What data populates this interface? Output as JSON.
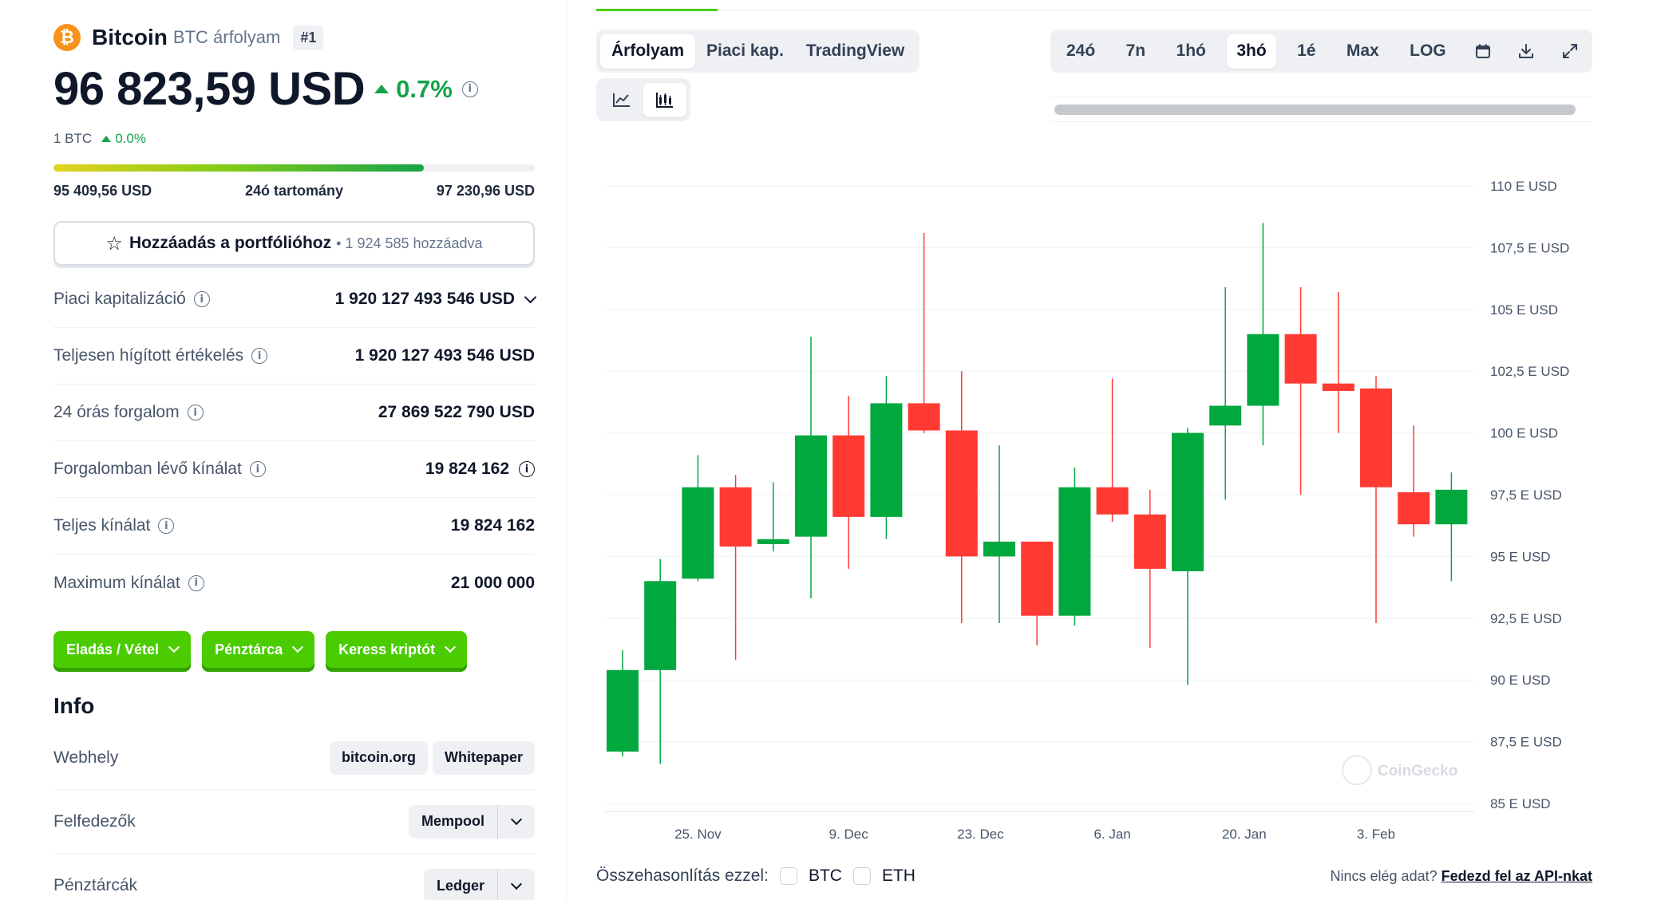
{
  "coin": {
    "logo_symbol": "₿",
    "name": "Bitcoin",
    "subtitle": "BTC árfolyam",
    "rank": "#1",
    "price": "96 823,59 USD",
    "change": "0.7%",
    "btc_unit": "1 BTC",
    "btc_change": "0.0%"
  },
  "range_24h": {
    "low": "95 409,56 USD",
    "label": "24ó tartomány",
    "high": "97 230,96 USD",
    "position_fraction": 0.77
  },
  "portfolio": {
    "label": "Hozzáadás a portfólióhoz",
    "count": "• 1 924 585 hozzáadva"
  },
  "stats": [
    {
      "label": "Piaci kapitalizáció",
      "value": "1 920 127 493 546 USD"
    },
    {
      "label": "Teljesen hígított értékelés",
      "value": "1 920 127 493 546 USD"
    },
    {
      "label": "24 órás forgalom",
      "value": "27 869 522 790 USD"
    },
    {
      "label": "Forgalomban lévő kínálat",
      "value": "19 824 162"
    },
    {
      "label": "Teljes kínálat",
      "value": "19 824 162"
    },
    {
      "label": "Maximum kínálat",
      "value": "21 000 000"
    }
  ],
  "actions": {
    "trade": "Eladás / Vétel",
    "wallet": "Pénztárca",
    "search": "Keress kriptót"
  },
  "info": {
    "title": "Info",
    "website_label": "Webhely",
    "website_link": "bitcoin.org",
    "whitepaper": "Whitepaper",
    "explorers_label": "Felfedezők",
    "explorer": "Mempool",
    "wallets_label": "Pénztárcák",
    "wallet": "Ledger"
  },
  "view_tabs": [
    "Árfolyam",
    "Piaci kap.",
    "TradingView"
  ],
  "range_tabs": [
    "24ó",
    "7n",
    "1hó",
    "3hó",
    "1é",
    "Max",
    "LOG"
  ],
  "active_range": "3hó",
  "icons": {
    "line_chart": "line-chart-icon",
    "candle_chart": "candlestick-chart-icon",
    "calendar": "calendar-icon",
    "download": "download-icon",
    "fullscreen": "expand-icon"
  },
  "colors": {
    "up": "#00a83e",
    "down": "#ff3a33",
    "accent": "#4bcc00"
  },
  "compare": {
    "label": "Összehasonlítás ezzel:",
    "options": [
      "BTC",
      "ETH"
    ]
  },
  "api_note": {
    "text": "Nincs elég adat?",
    "link": "Fedezd fel az API-nkat"
  },
  "chart_data": {
    "type": "candlestick",
    "watermark": "CoinGecko",
    "y_ticks": [
      85000,
      87500,
      90000,
      92500,
      95000,
      97500,
      100000,
      102500,
      105000,
      107500,
      110000
    ],
    "y_tick_labels": [
      "85 E USD",
      "87,5 E USD",
      "90 E USD",
      "92,5 E USD",
      "95 E USD",
      "97,5 E USD",
      "100 E USD",
      "102,5 E USD",
      "105 E USD",
      "107,5 E USD",
      "110 E USD"
    ],
    "ylim": [
      85000,
      110000
    ],
    "x_tick_labels": [
      "25. Nov",
      "9. Dec",
      "23. Dec",
      "6. Jan",
      "20. Jan",
      "3. Feb"
    ],
    "x_tick_candle_index": [
      2,
      6,
      9.5,
      13,
      16.5,
      20
    ],
    "candles": [
      {
        "o": 87100,
        "h": 91200,
        "l": 86900,
        "c": 90400
      },
      {
        "o": 90400,
        "h": 94900,
        "l": 86600,
        "c": 94000
      },
      {
        "o": 94100,
        "h": 99100,
        "l": 94000,
        "c": 97800
      },
      {
        "o": 97800,
        "h": 98300,
        "l": 90800,
        "c": 95400
      },
      {
        "o": 95500,
        "h": 98000,
        "l": 95200,
        "c": 95700
      },
      {
        "o": 95800,
        "h": 103900,
        "l": 93300,
        "c": 99900
      },
      {
        "o": 99900,
        "h": 101500,
        "l": 94500,
        "c": 96600
      },
      {
        "o": 96600,
        "h": 102300,
        "l": 95700,
        "c": 101200
      },
      {
        "o": 101200,
        "h": 108100,
        "l": 100000,
        "c": 100100
      },
      {
        "o": 100100,
        "h": 102500,
        "l": 92300,
        "c": 95000
      },
      {
        "o": 95000,
        "h": 99500,
        "l": 92300,
        "c": 95600
      },
      {
        "o": 95600,
        "h": 93200,
        "l": 91400,
        "c": 92600
      },
      {
        "o": 92600,
        "h": 98600,
        "l": 92200,
        "c": 97800
      },
      {
        "o": 97800,
        "h": 102200,
        "l": 96400,
        "c": 96700
      },
      {
        "o": 96700,
        "h": 97700,
        "l": 91300,
        "c": 94500
      },
      {
        "o": 94400,
        "h": 100200,
        "l": 89800,
        "c": 100000
      },
      {
        "o": 100300,
        "h": 105900,
        "l": 97300,
        "c": 101100
      },
      {
        "o": 101100,
        "h": 108500,
        "l": 99500,
        "c": 104000
      },
      {
        "o": 104000,
        "h": 105900,
        "l": 97500,
        "c": 102000
      },
      {
        "o": 102000,
        "h": 105700,
        "l": 100000,
        "c": 101700
      },
      {
        "o": 101800,
        "h": 102300,
        "l": 92300,
        "c": 97800
      },
      {
        "o": 97600,
        "h": 100300,
        "l": 95800,
        "c": 96300
      },
      {
        "o": 96300,
        "h": 98400,
        "l": 94000,
        "c": 97700
      }
    ]
  }
}
